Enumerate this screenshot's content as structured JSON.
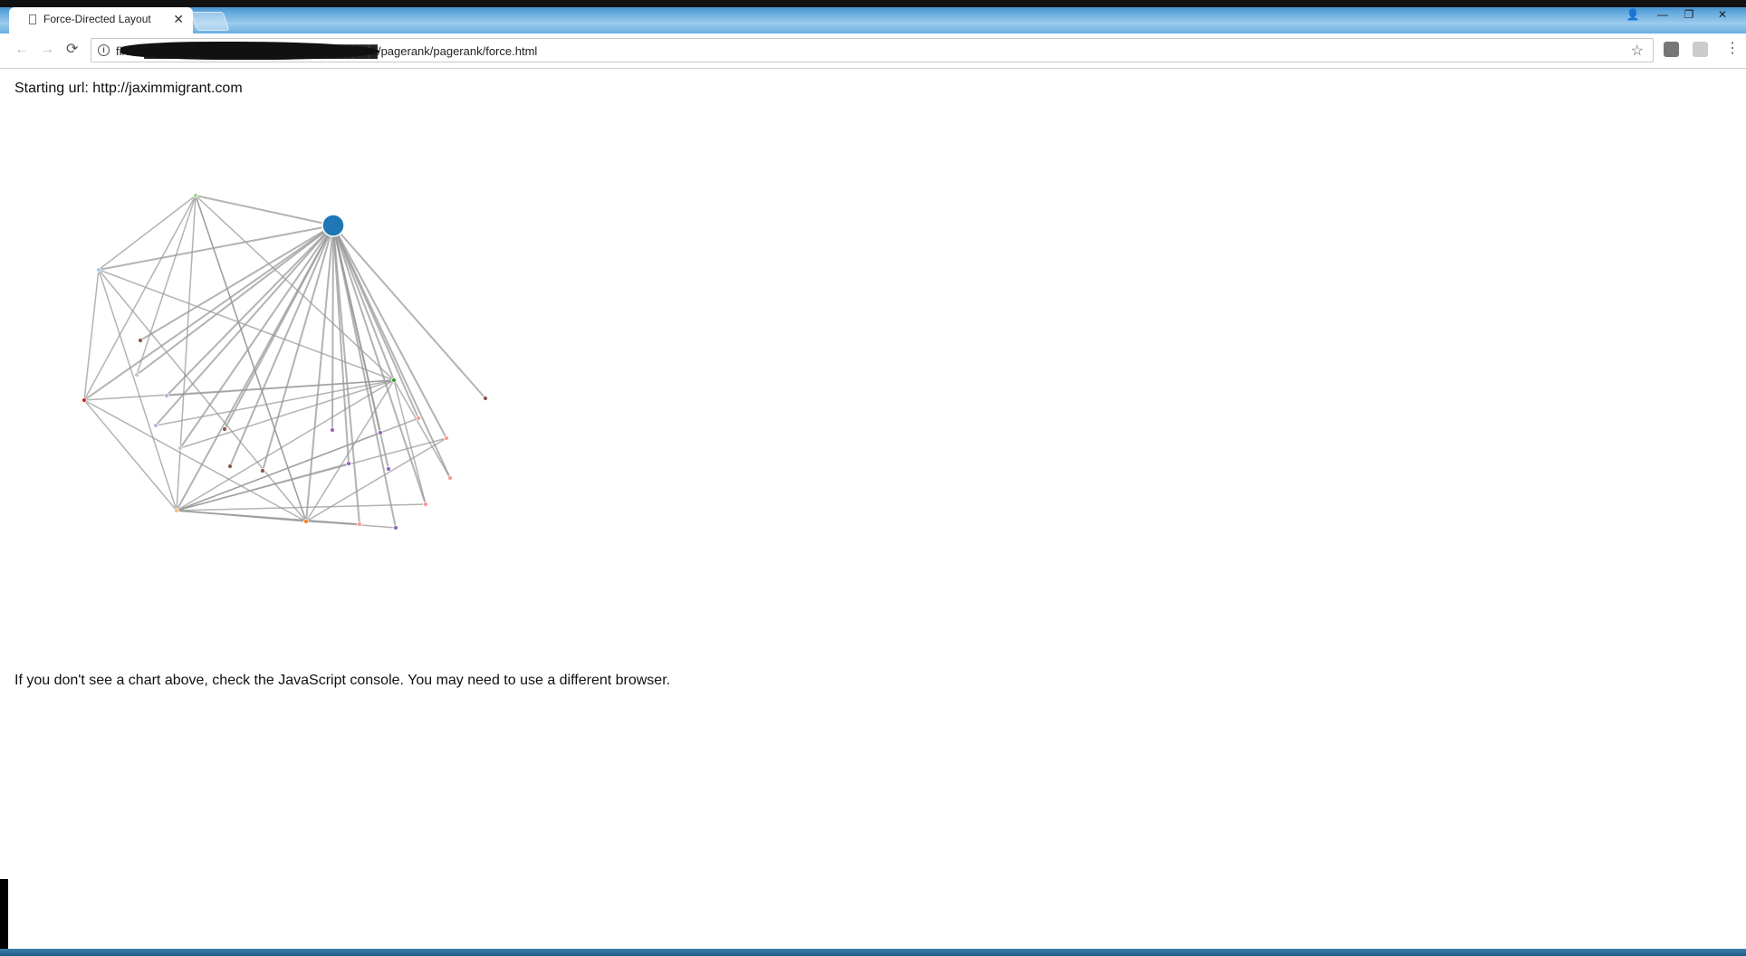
{
  "browser": {
    "tab_title": "Force-Directed Layout",
    "close_glyph": "✕",
    "url": "file:///████████████████████████████/pagerank/pagerank/force.html",
    "back_glyph": "←",
    "forward_glyph": "→",
    "reload_glyph": "⟳",
    "star_glyph": "☆",
    "menu_glyph": "⋮",
    "window_controls": {
      "user": "👤",
      "minimize": "—",
      "maximize": "❐",
      "close": "✕"
    }
  },
  "page": {
    "starting_url_text": "Starting url: http://jaximmigrant.com",
    "footer_text": "If you don't see a chart above, check the JavaScript console. You may need to use a different browser."
  },
  "chart_data": {
    "type": "network",
    "nodes": [
      {
        "id": "hub",
        "color": "#1f77b4"
      },
      {
        "id": "n1",
        "color": "#98df8a"
      },
      {
        "id": "n2",
        "color": "#aec7e8"
      },
      {
        "id": "n3",
        "color": "#d62728"
      },
      {
        "id": "n4",
        "color": "#ffbb78"
      },
      {
        "id": "n5",
        "color": "#ff9896"
      },
      {
        "id": "n6",
        "color": "#2ca02c"
      },
      {
        "id": "n7",
        "color": "#8c564b"
      },
      {
        "id": "n8",
        "color": "#c7c7c7"
      },
      {
        "id": "n9",
        "color": "#c5b0d5"
      },
      {
        "id": "n10",
        "color": "#c5b0d5"
      },
      {
        "id": "n11",
        "color": "#8c564b"
      },
      {
        "id": "n12",
        "color": "#c7c7c7"
      },
      {
        "id": "n13",
        "color": "#8c564b"
      },
      {
        "id": "n14",
        "color": "#8c564b"
      },
      {
        "id": "n15",
        "color": "#9467bd"
      },
      {
        "id": "n16",
        "color": "#9467bd"
      },
      {
        "id": "n17",
        "color": "#9467bd"
      },
      {
        "id": "n18",
        "color": "#9467bd"
      },
      {
        "id": "n19",
        "color": "#ff9896"
      },
      {
        "id": "n20",
        "color": "#ff9896"
      },
      {
        "id": "n21",
        "color": "#ff9896"
      },
      {
        "id": "n22",
        "color": "#ff9896"
      },
      {
        "id": "n23",
        "color": "#ff7f0e"
      },
      {
        "id": "n24",
        "color": "#ff9896"
      },
      {
        "id": "n25",
        "color": "#9467bd"
      },
      {
        "id": "n26",
        "color": "#8c564b"
      }
    ],
    "links": [
      [
        "hub",
        "n1"
      ],
      [
        "hub",
        "n2"
      ],
      [
        "hub",
        "n3"
      ],
      [
        "hub",
        "n4"
      ],
      [
        "hub",
        "n6"
      ],
      [
        "hub",
        "n7"
      ],
      [
        "hub",
        "n8"
      ],
      [
        "hub",
        "n9"
      ],
      [
        "hub",
        "n10"
      ],
      [
        "hub",
        "n11"
      ],
      [
        "hub",
        "n12"
      ],
      [
        "hub",
        "n13"
      ],
      [
        "hub",
        "n14"
      ],
      [
        "hub",
        "n15"
      ],
      [
        "hub",
        "n16"
      ],
      [
        "hub",
        "n17"
      ],
      [
        "hub",
        "n18"
      ],
      [
        "hub",
        "n19"
      ],
      [
        "hub",
        "n20"
      ],
      [
        "hub",
        "n21"
      ],
      [
        "hub",
        "n22"
      ],
      [
        "hub",
        "n23"
      ],
      [
        "hub",
        "n24"
      ],
      [
        "hub",
        "n25"
      ],
      [
        "hub",
        "n26"
      ],
      [
        "n1",
        "n2"
      ],
      [
        "n1",
        "n3"
      ],
      [
        "n1",
        "n4"
      ],
      [
        "n1",
        "n6"
      ],
      [
        "n1",
        "n23"
      ],
      [
        "n1",
        "n8"
      ],
      [
        "n2",
        "n3"
      ],
      [
        "n2",
        "n4"
      ],
      [
        "n2",
        "n6"
      ],
      [
        "n2",
        "n23"
      ],
      [
        "n3",
        "n4"
      ],
      [
        "n3",
        "n6"
      ],
      [
        "n3",
        "n23"
      ],
      [
        "n4",
        "n6"
      ],
      [
        "n4",
        "n23"
      ],
      [
        "n4",
        "n16"
      ],
      [
        "n4",
        "n17"
      ],
      [
        "n4",
        "n19"
      ],
      [
        "n4",
        "n20"
      ],
      [
        "n4",
        "n22"
      ],
      [
        "n4",
        "n24"
      ],
      [
        "n4",
        "n25"
      ],
      [
        "n6",
        "n9"
      ],
      [
        "n6",
        "n10"
      ],
      [
        "n6",
        "n12"
      ],
      [
        "n6",
        "n23"
      ],
      [
        "n6",
        "n21"
      ],
      [
        "n6",
        "n22"
      ],
      [
        "n23",
        "n1"
      ],
      [
        "n23",
        "n20"
      ],
      [
        "n23",
        "n24"
      ]
    ]
  }
}
